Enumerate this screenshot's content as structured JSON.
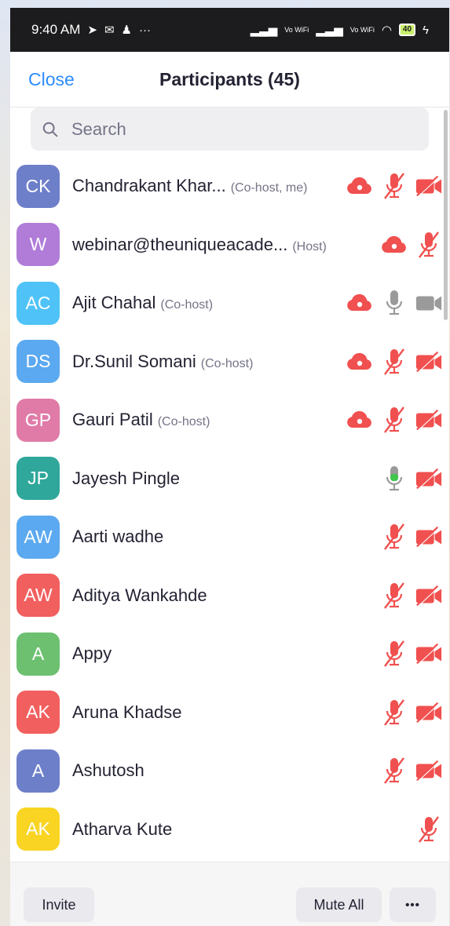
{
  "status_bar": {
    "time": "9:40 AM",
    "vowifi1": "Vo WiFi",
    "vowifi2": "Vo WiFi",
    "battery": "40"
  },
  "header": {
    "close_label": "Close",
    "title": "Participants (45)"
  },
  "search": {
    "placeholder": "Search"
  },
  "participants": [
    {
      "initials": "CK",
      "name": "Chandrakant Khar...",
      "role": "(Co-host, me)",
      "avatar_color": "#6e7fc9",
      "record": true,
      "mic": "muted",
      "video": "off"
    },
    {
      "initials": "W",
      "name": "webinar@theuniqueacade...",
      "role": "(Host)",
      "avatar_color": "#b07cd8",
      "record": true,
      "mic": "muted",
      "video": "none"
    },
    {
      "initials": "AC",
      "name": "Ajit Chahal",
      "role": "(Co-host)",
      "avatar_color": "#4fc3f7",
      "record": true,
      "mic": "idle",
      "video": "idle"
    },
    {
      "initials": "DS",
      "name": "Dr.Sunil Somani",
      "role": "(Co-host)",
      "avatar_color": "#5ba9f0",
      "record": true,
      "mic": "muted",
      "video": "off"
    },
    {
      "initials": "GP",
      "name": "Gauri Patil",
      "role": "(Co-host)",
      "avatar_color": "#e07ba8",
      "record": true,
      "mic": "muted",
      "video": "off"
    },
    {
      "initials": "JP",
      "name": "Jayesh Pingle",
      "role": "",
      "avatar_color": "#2fa79a",
      "record": false,
      "mic": "active",
      "video": "off"
    },
    {
      "initials": "AW",
      "name": "Aarti wadhe",
      "role": "",
      "avatar_color": "#5ba9f0",
      "record": false,
      "mic": "muted",
      "video": "off"
    },
    {
      "initials": "AW",
      "name": "Aditya Wankahde",
      "role": "",
      "avatar_color": "#f25f5f",
      "record": false,
      "mic": "muted",
      "video": "off"
    },
    {
      "initials": "A",
      "name": "Appy",
      "role": "",
      "avatar_color": "#6cc070",
      "record": false,
      "mic": "muted",
      "video": "off"
    },
    {
      "initials": "AK",
      "name": "Aruna Khadse",
      "role": "",
      "avatar_color": "#f25f5f",
      "record": false,
      "mic": "muted",
      "video": "off"
    },
    {
      "initials": "A",
      "name": "Ashutosh",
      "role": "",
      "avatar_color": "#6e7fc9",
      "record": false,
      "mic": "muted",
      "video": "off"
    },
    {
      "initials": "AK",
      "name": "Atharva Kute",
      "role": "",
      "avatar_color": "#f9d423",
      "record": false,
      "mic": "muted",
      "video": "none"
    }
  ],
  "footer": {
    "invite_label": "Invite",
    "mute_all_label": "Mute All",
    "more_label": "•••"
  },
  "colors": {
    "accent": "#2d8cff",
    "muted_red": "#f0504f",
    "active_green": "#3ec74b",
    "idle_gray": "#9a9a9a"
  }
}
